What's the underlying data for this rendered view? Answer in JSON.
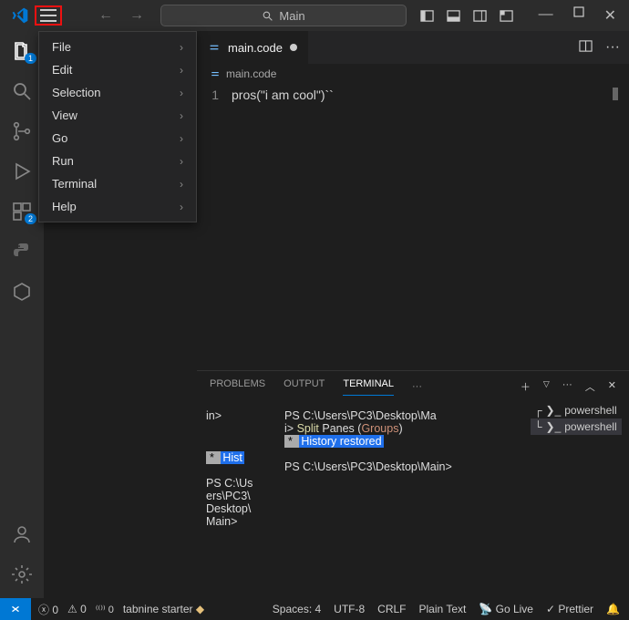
{
  "titleBar": {
    "search_text": "Main",
    "win_min": "—",
    "win_close": "✕"
  },
  "appMenu": [
    {
      "label": "File",
      "sub": true
    },
    {
      "label": "Edit",
      "sub": true
    },
    {
      "label": "Selection",
      "sub": true
    },
    {
      "label": "View",
      "sub": true
    },
    {
      "label": "Go",
      "sub": true
    },
    {
      "label": "Run",
      "sub": true
    },
    {
      "label": "Terminal",
      "sub": true
    },
    {
      "label": "Help",
      "sub": true
    }
  ],
  "activity": {
    "explorer_badge": "1",
    "extensions_badge": "2"
  },
  "editor": {
    "tab_label": "main.code",
    "breadcrumb": "main.code",
    "line_no": "1",
    "code_line": "pros(\"i am cool\")``"
  },
  "panel": {
    "tabs": {
      "problems": "PROBLEMS",
      "output": "OUTPUT",
      "terminal": "TERMINAL"
    },
    "left": {
      "l1": "in>",
      "hist_star": " * ",
      "hist": "Hist",
      "wrap": "PS C:\\Us\ners\\PC3\\\nDesktop\\\nMain>"
    },
    "mid": {
      "l1": "PS C:\\Users\\PC3\\Desktop\\Ma",
      "l2_prompt": "i> ",
      "l2_split": "Split",
      "l2_panes": " Panes (",
      "l2_groups": "Groups",
      "l2_end": ")",
      "hist_star": " * ",
      "hist": "History restored",
      "l4": "PS C:\\Users\\PC3\\Desktop\\Main>"
    },
    "termList": {
      "a": "powershell",
      "b": "powershell"
    }
  },
  "status": {
    "errors": "0",
    "warnings": "0",
    "ports": "0",
    "tabnine": "tabnine starter",
    "spaces": "Spaces: 4",
    "encoding": "UTF-8",
    "eol": "CRLF",
    "lang": "Plain Text",
    "golive": "Go Live",
    "prettier": "Prettier"
  }
}
